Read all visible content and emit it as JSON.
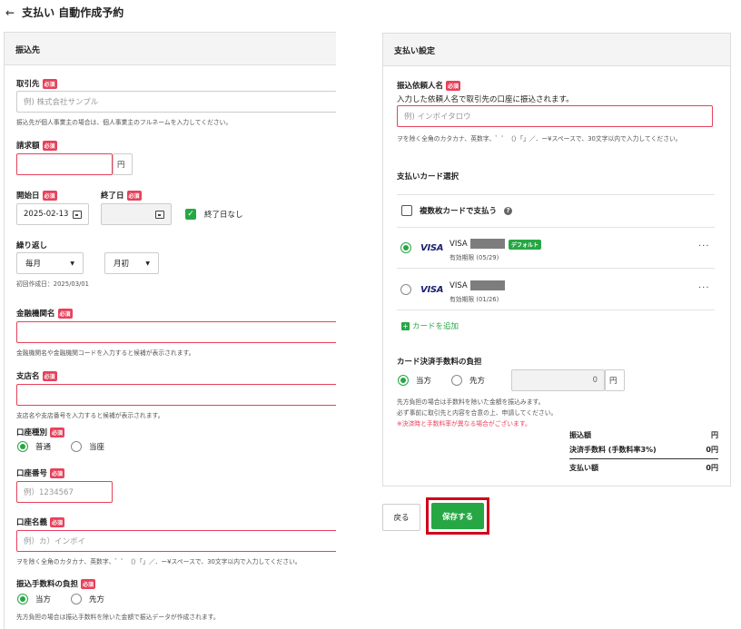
{
  "page": {
    "back_icon": "←",
    "title": "支払い 自動作成予約"
  },
  "left": {
    "header": "振込先",
    "required": "必須",
    "payee": {
      "label": "取引先",
      "placeholder": "例) 株式会社サンプル",
      "hint": "振込先が個人事業主の場合は、個人事業主のフルネームを入力してください。"
    },
    "amount": {
      "label": "請求額",
      "unit": "円"
    },
    "start": {
      "label": "開始日",
      "value": "2025-02-13"
    },
    "end": {
      "label": "終了日",
      "no_end_label": "終了日なし"
    },
    "repeat": {
      "label": "繰り返し",
      "freq": "毎月",
      "day": "月初",
      "first_date": "初回作成日：2025/03/01"
    },
    "bank": {
      "label": "金融機関名",
      "hint": "金融機関名や金融機関コードを入力すると候補が表示されます。"
    },
    "branch": {
      "label": "支店名",
      "hint": "支店名や支店番号を入力すると候補が表示されます。"
    },
    "account_type": {
      "label": "口座種別",
      "opt1": "普通",
      "opt2": "当座"
    },
    "account_no": {
      "label": "口座番号",
      "placeholder": "例）1234567"
    },
    "account_name": {
      "label": "口座名義",
      "placeholder": "例）カ）インボイ",
      "hint": "ヲを除く全角のカタカナ、英数字、゛゜（）「」／．ー¥スペースで、30文字以内で入力してください。"
    },
    "fee": {
      "label": "振込手数料の負担",
      "opt1": "当方",
      "opt2": "先方",
      "hint": "先方負担の場合は振込手数料を除いた金額で振込データが作成されます。"
    }
  },
  "right": {
    "header": "支払い設定",
    "requester": {
      "label": "振込依頼人名",
      "desc": "入力した依頼人名で取引先の口座に振込されます。",
      "placeholder": "例) インボイタロウ",
      "hint": "ヲを除く全角のカタカナ、英数字、゛゜（）「」／．ー¥スペースで、30文字以内で入力してください。"
    },
    "card_select": {
      "label": "支払いカード選択",
      "multi_label": "複数枚カードで支払う",
      "help": "?"
    },
    "cards": [
      {
        "brand": "VISA",
        "name": "VISA",
        "expiry": "有効期限 (05/29)",
        "badge": "デフォルト",
        "menu": "···"
      },
      {
        "brand": "VISA",
        "name": "VISA",
        "expiry": "有効期限 (01/26)",
        "menu": "···"
      }
    ],
    "add_card": "カードを追加",
    "card_fee": {
      "label": "カード決済手数料の負担",
      "opt1": "当方",
      "opt2": "先方",
      "value": "0",
      "unit": "円",
      "hint1": "先方負担の場合は手数料を除いた金額を振込みます。",
      "hint2": "必ず事前に取引先と内容を合意の上、申請してください。",
      "warn": "※決済時と手数料率が異なる場合がございます。"
    },
    "summary": [
      {
        "label": "振込額",
        "value": "円"
      },
      {
        "label": "決済手数料 (手数料率3%)",
        "value": "0円"
      },
      {
        "label": "支払い額",
        "value": "0円"
      }
    ]
  },
  "buttons": {
    "back": "戻る",
    "save": "保存する"
  },
  "colors": {
    "accent": "#27a744",
    "required": "#e7415b",
    "highlight": "#d0021b"
  }
}
